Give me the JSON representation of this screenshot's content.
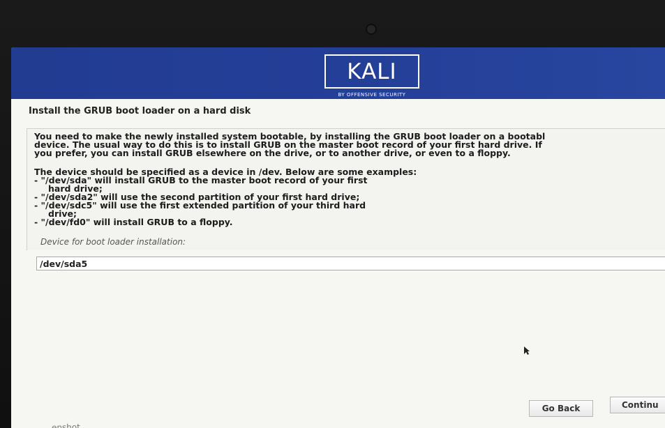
{
  "brand": {
    "logo_text": "KALI",
    "tagline": "BY OFFENSIVE SECURITY"
  },
  "page": {
    "title": "Install the GRUB boot loader on a hard disk"
  },
  "content": {
    "paragraph_1": [
      "You need to make the newly installed system bootable, by installing the GRUB boot loader on a bootabl",
      "device. The usual way to do this is to install GRUB on the master boot record of your first hard drive. If",
      "you prefer, you can install GRUB elsewhere on the drive, or to another drive, or even to a floppy."
    ],
    "paragraph_2_intro": "The device should be specified as a device in /dev. Below are some examples:",
    "examples": [
      "- \"/dev/sda\" will install GRUB to the master boot record of your first",
      "hard drive;",
      "- \"/dev/sda2\" will use the second partition of your first hard drive;",
      "- \"/dev/sdc5\" will use the first extended partition of your third hard",
      "drive;",
      "- \"/dev/fd0\" will install GRUB to a floppy."
    ]
  },
  "field": {
    "label": "Device for boot loader installation:",
    "value": "/dev/sda5"
  },
  "buttons": {
    "back": "Go Back",
    "continue": "Continu"
  },
  "footer": {
    "fragment": "enshot"
  },
  "colors": {
    "banner": "#243f98",
    "screen_background": "#f6f6f2",
    "text": "#1c1c1c"
  },
  "icons": {
    "pointer": "mouse-pointer-icon"
  }
}
